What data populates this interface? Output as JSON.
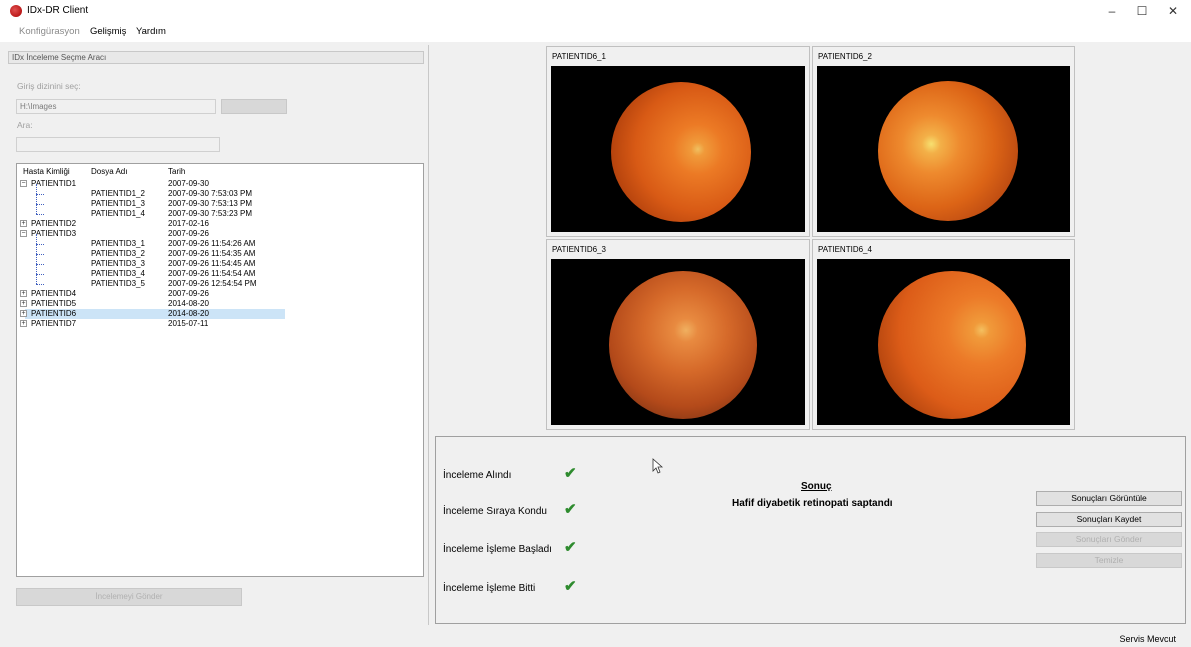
{
  "window": {
    "title": "IDx-DR Client",
    "minimize": "–",
    "maximize": "☐",
    "close": "✕"
  },
  "menu": {
    "items": [
      {
        "label": "Konfigürasyon",
        "enabled": false
      },
      {
        "label": "Gelişmiş",
        "enabled": true
      },
      {
        "label": "Yardım",
        "enabled": true
      }
    ]
  },
  "left": {
    "group_title": "IDx İnceleme Seçme Aracı",
    "input_dir_label": "Giriş dizinini seç:",
    "input_dir_value": "H:\\Images",
    "search_label": "Ara:",
    "search_value": "",
    "tree": {
      "headers": [
        "Hasta Kimliği",
        "Dosya Adı",
        "Tarih"
      ],
      "rows": [
        {
          "id": "PATIENTID1",
          "file": "",
          "date": "2007-09-30",
          "level": 0,
          "expanded": true,
          "selected": false
        },
        {
          "id": "",
          "file": "PATIENTID1_2",
          "date": "2007-09-30 7:53:03 PM",
          "level": 1,
          "selected": false
        },
        {
          "id": "",
          "file": "PATIENTID1_3",
          "date": "2007-09-30 7:53:13 PM",
          "level": 1,
          "selected": false
        },
        {
          "id": "",
          "file": "PATIENTID1_4",
          "date": "2007-09-30 7:53:23 PM",
          "level": 1,
          "selected": false
        },
        {
          "id": "PATIENTID2",
          "file": "",
          "date": "2017-02-16",
          "level": 0,
          "expanded": false,
          "selected": false
        },
        {
          "id": "PATIENTID3",
          "file": "",
          "date": "2007-09-26",
          "level": 0,
          "expanded": true,
          "selected": false
        },
        {
          "id": "",
          "file": "PATIENTID3_1",
          "date": "2007-09-26 11:54:26 AM",
          "level": 1,
          "selected": false
        },
        {
          "id": "",
          "file": "PATIENTID3_2",
          "date": "2007-09-26 11:54:35 AM",
          "level": 1,
          "selected": false
        },
        {
          "id": "",
          "file": "PATIENTID3_3",
          "date": "2007-09-26 11:54:45 AM",
          "level": 1,
          "selected": false
        },
        {
          "id": "",
          "file": "PATIENTID3_4",
          "date": "2007-09-26 11:54:54 AM",
          "level": 1,
          "selected": false
        },
        {
          "id": "",
          "file": "PATIENTID3_5",
          "date": "2007-09-26 12:54:54 PM",
          "level": 1,
          "selected": false
        },
        {
          "id": "PATIENTID4",
          "file": "",
          "date": "2007-09-26",
          "level": 0,
          "expanded": false,
          "selected": false
        },
        {
          "id": "PATIENTID5",
          "file": "",
          "date": "2014-08-20",
          "level": 0,
          "expanded": false,
          "selected": false
        },
        {
          "id": "PATIENTID6",
          "file": "",
          "date": "2014-08-20",
          "level": 0,
          "expanded": false,
          "selected": true
        },
        {
          "id": "PATIENTID7",
          "file": "",
          "date": "2015-07-11",
          "level": 0,
          "expanded": false,
          "selected": false
        }
      ]
    },
    "submit_button": "İncelemeyi Gönder"
  },
  "images": [
    {
      "label": "PATIENTID6_1"
    },
    {
      "label": "PATIENTID6_2"
    },
    {
      "label": "PATIENTID6_3"
    },
    {
      "label": "PATIENTID6_4"
    }
  ],
  "status_steps": [
    {
      "label": "İnceleme Alındı",
      "done": true
    },
    {
      "label": "İnceleme Sıraya Kondu",
      "done": true
    },
    {
      "label": "İnceleme İşleme Başladı",
      "done": true
    },
    {
      "label": "İnceleme İşleme Bitti",
      "done": true
    }
  ],
  "result": {
    "title": "Sonuç",
    "text": "Hafif diyabetik retinopati saptandı"
  },
  "actions": [
    {
      "label": "Sonuçları Görüntüle",
      "enabled": true
    },
    {
      "label": "Sonuçları Kaydet",
      "enabled": true
    },
    {
      "label": "Sonuçları Gönder",
      "enabled": false
    },
    {
      "label": "Temizle",
      "enabled": false
    }
  ],
  "statusbar": {
    "text": "Servis Mevcut"
  },
  "colors": {
    "check": "#2e8b2e",
    "selection": "#cce4f7",
    "fundus": "#e8641e"
  }
}
